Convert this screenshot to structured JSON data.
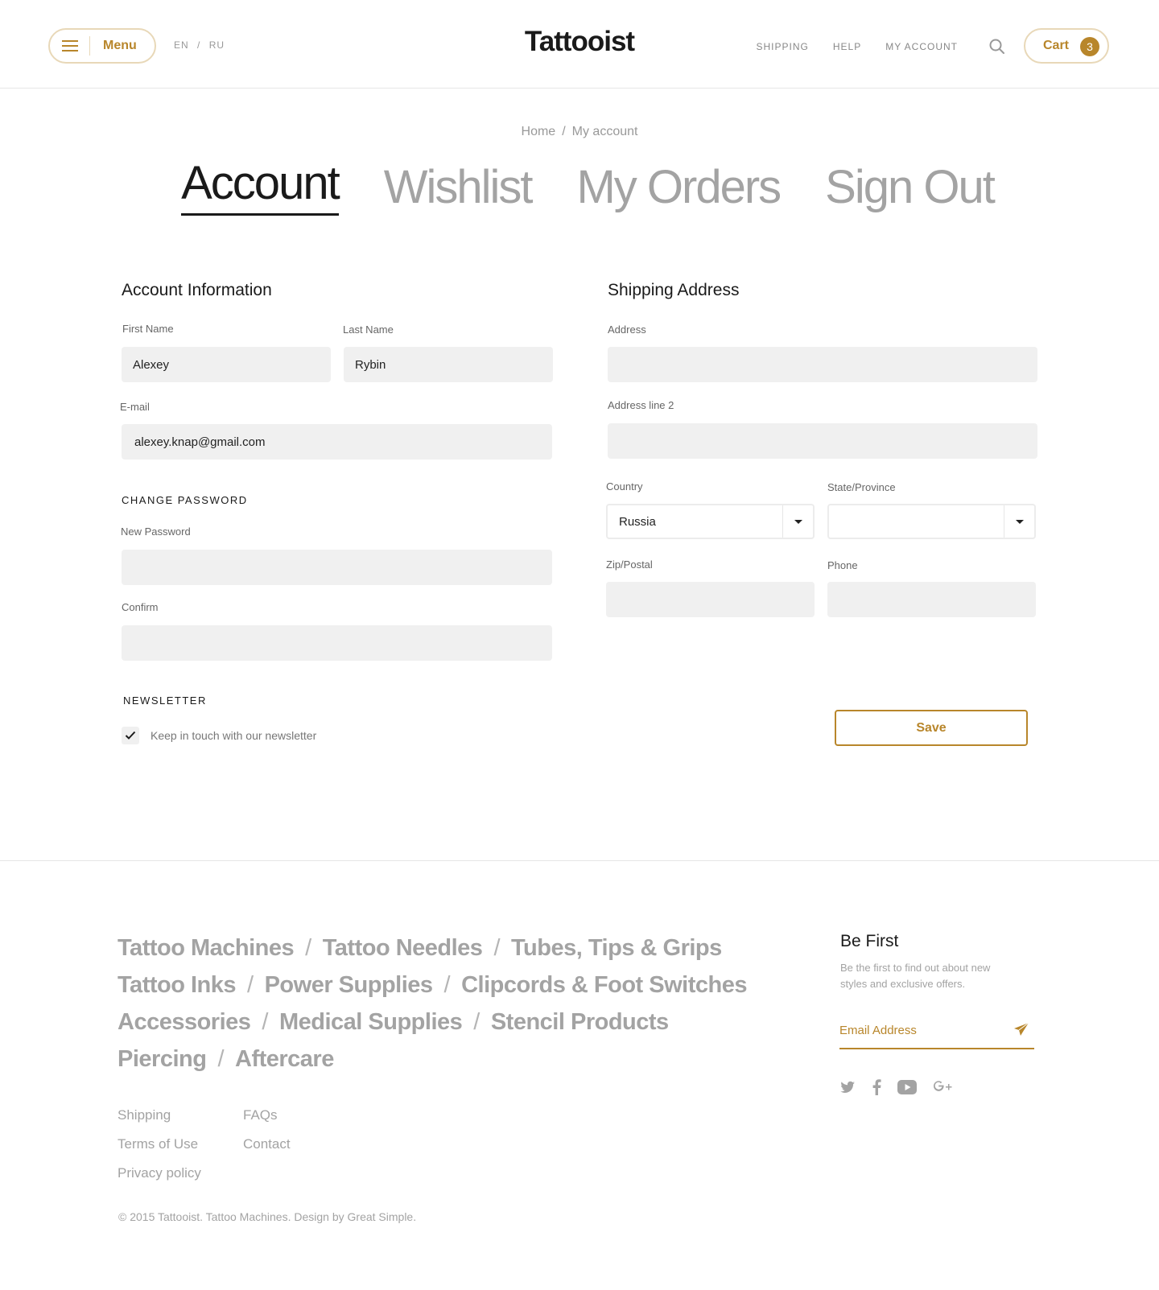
{
  "header": {
    "menu_label": "Menu",
    "lang_en": "EN",
    "lang_sep": "/",
    "lang_ru": "RU",
    "logo": "Tattooist",
    "nav": [
      "SHIPPING",
      "HELP",
      "MY ACCOUNT"
    ],
    "cart_label": "Cart",
    "cart_count": "3",
    "icons": [
      "hamburger-icon",
      "search-icon"
    ]
  },
  "breadcrumb": {
    "home": "Home",
    "sep": "/",
    "current": "My account"
  },
  "tabs": [
    {
      "label": "Account",
      "active": true
    },
    {
      "label": "Wishlist",
      "active": false
    },
    {
      "label": "My Orders",
      "active": false
    },
    {
      "label": "Sign Out",
      "active": false
    }
  ],
  "account": {
    "title": "Account Information",
    "first_name_label": "First Name",
    "first_name_value": "Alexey",
    "last_name_label": "Last Name",
    "last_name_value": "Rybin",
    "email_label": "E-mail",
    "email_value": "alexey.knap@gmail.com",
    "change_password_title": "CHANGE PASSWORD",
    "new_password_label": "New Password",
    "confirm_label": "Confirm",
    "newsletter_title": "NEWSLETTER",
    "newsletter_checkbox_label": "Keep in touch with our newsletter",
    "newsletter_checked": true
  },
  "shipping": {
    "title": "Shipping Address",
    "address_label": "Address",
    "address2_label": "Address line 2",
    "country_label": "Country",
    "country_value": "Russia",
    "state_label": "State/Province",
    "state_value": "",
    "zip_label": "Zip/Postal",
    "phone_label": "Phone",
    "save_label": "Save"
  },
  "footer": {
    "category_rows": [
      [
        "Tattoo Machines",
        "Tattoo Needles",
        "Tubes, Tips & Grips"
      ],
      [
        "Tattoo Inks",
        "Power Supplies",
        "Clipcords & Foot Switches"
      ],
      [
        "Accessories",
        "Medical Supplies",
        "Stencil Products"
      ],
      [
        "Piercing",
        "Aftercare"
      ]
    ],
    "separator": "/",
    "links_col1": [
      "Shipping",
      "Terms of Use",
      "Privacy policy"
    ],
    "links_col2": [
      "FAQs",
      "Contact"
    ],
    "copyright": "© 2015 Tattooist. Tattoo Machines.  Design by Great Simple.",
    "be_first_title": "Be First",
    "be_first_text": "Be the first to find out about new styles and exclusive offers.",
    "email_placeholder": "Email Address",
    "social_icons": [
      "twitter-icon",
      "facebook-icon",
      "youtube-icon",
      "google-plus-icon"
    ]
  },
  "colors": {
    "accent": "#b8862b",
    "field_bg": "#f0f0f0",
    "muted_text": "#a3a3a3"
  }
}
